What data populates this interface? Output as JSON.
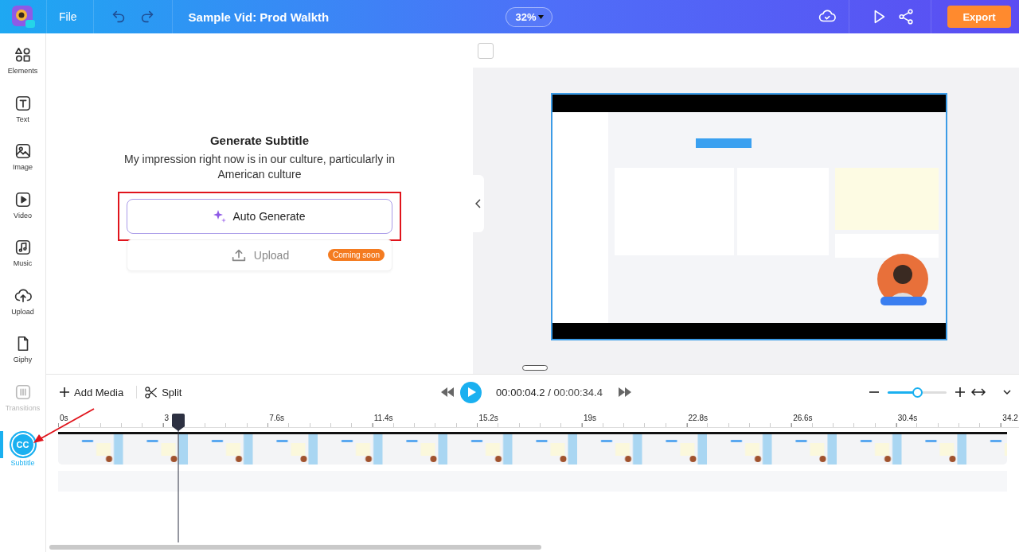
{
  "topbar": {
    "menu": "File",
    "title": "Sample Vid: Prod Walkth",
    "zoom": "32%",
    "export": "Export"
  },
  "sidebar": [
    {
      "label": "Elements",
      "selected": false,
      "disabled": false
    },
    {
      "label": "Text",
      "selected": false,
      "disabled": false
    },
    {
      "label": "Image",
      "selected": false,
      "disabled": false
    },
    {
      "label": "Video",
      "selected": false,
      "disabled": false
    },
    {
      "label": "Music",
      "selected": false,
      "disabled": false
    },
    {
      "label": "Upload",
      "selected": false,
      "disabled": false
    },
    {
      "label": "Giphy",
      "selected": false,
      "disabled": false
    },
    {
      "label": "Transitions",
      "selected": false,
      "disabled": true
    },
    {
      "label": "Subtitle",
      "glyph": "CC",
      "selected": true,
      "disabled": false
    }
  ],
  "subtitle_panel": {
    "title": "Generate Subtitle",
    "text": "My impression right now is in our culture, particularly in American culture",
    "auto_button": "Auto Generate",
    "highlighted": true,
    "upload_button": "Upload",
    "upload_disabled": true,
    "upload_badge": "Coming soon"
  },
  "preview": {
    "checkbox": {
      "checked": false
    }
  },
  "timeline": {
    "add_media": "Add Media",
    "split": "Split",
    "current_time": "00:00:04.2",
    "separator": "/",
    "total_time": "00:00:34.4",
    "zoom": {
      "level": 0.5
    },
    "ticks": [
      "0s",
      "3",
      "7.6s",
      "11.4s",
      "15.2s",
      "19s",
      "22.8s",
      "26.6s",
      "30.4s",
      "34.2"
    ]
  }
}
